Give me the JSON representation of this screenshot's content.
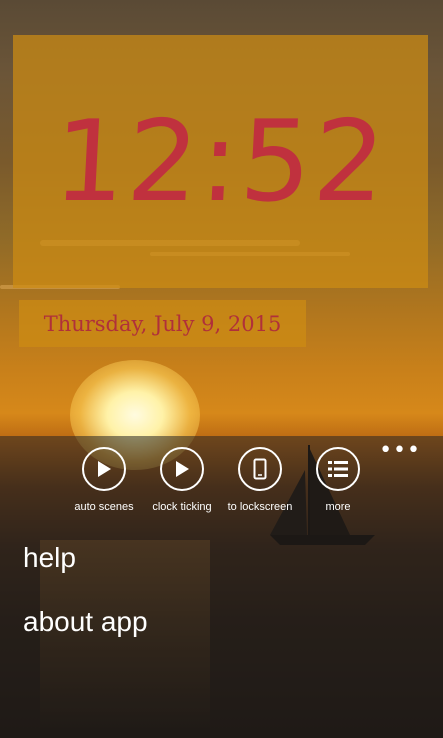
{
  "clock": {
    "time": "12:52",
    "date": "Thursday, July 9, 2015"
  },
  "appbar": {
    "buttons": [
      {
        "label": "auto scenes",
        "icon": "play-icon"
      },
      {
        "label": "clock ticking",
        "icon": "play-icon"
      },
      {
        "label": "to lockscreen",
        "icon": "phone-icon"
      },
      {
        "label": "more",
        "icon": "list-icon"
      }
    ],
    "ellipsis": "•••"
  },
  "menu": {
    "items": [
      "help",
      "about app"
    ]
  },
  "colors": {
    "clock_text": "#c0313e",
    "tile_bg": "#cd8c14",
    "appbar_bg": "#282624"
  }
}
